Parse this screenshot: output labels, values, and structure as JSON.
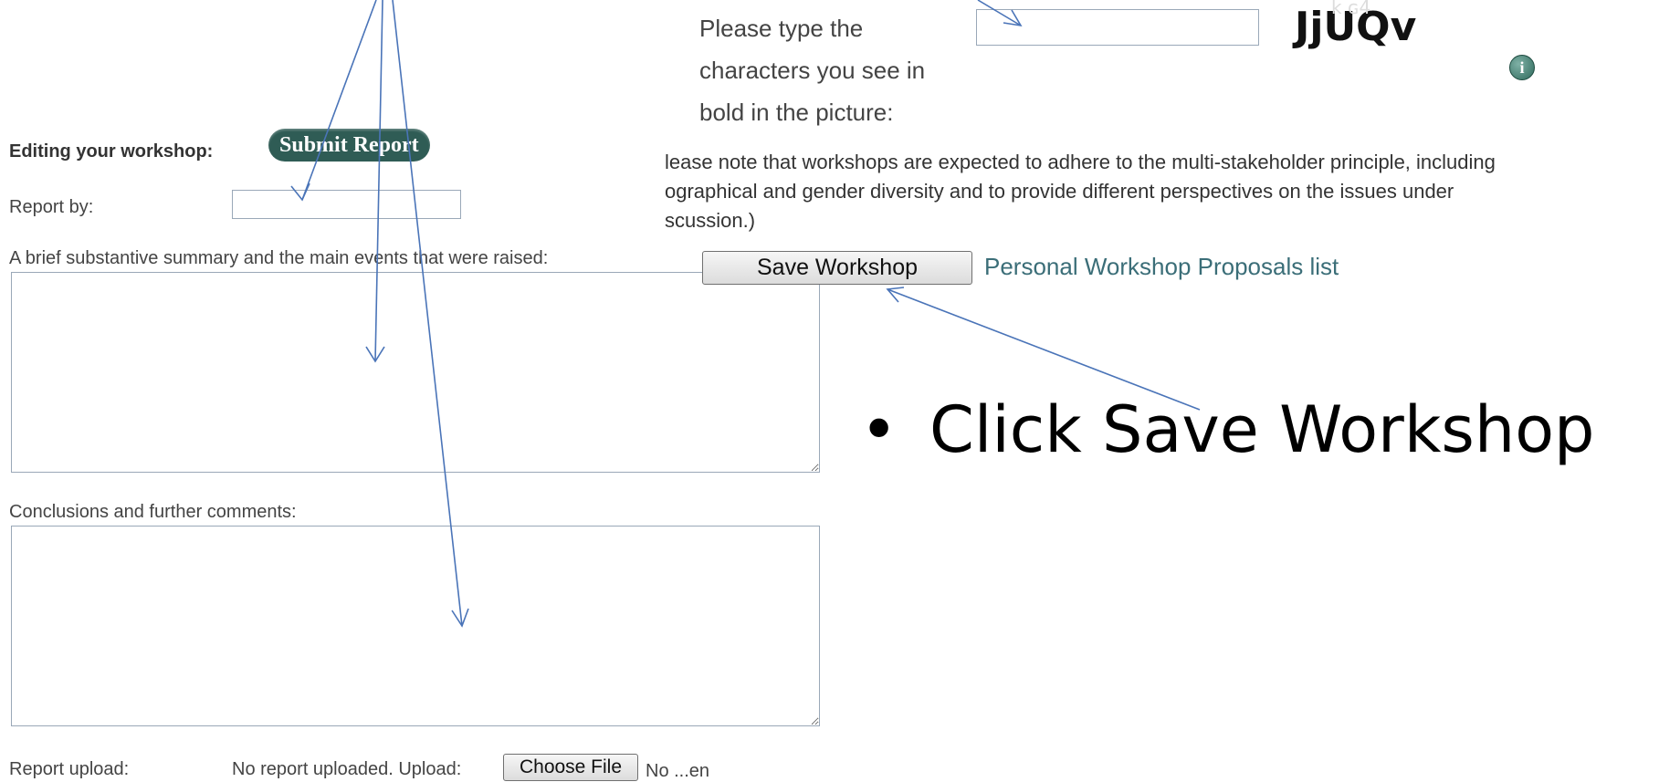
{
  "captcha": {
    "prompt_line1": "Please type the",
    "prompt_line2": "characters you see in",
    "prompt_line3": "bold in the picture:",
    "input_value": "",
    "image_text": "JjUQv",
    "info_icon": "info-icon"
  },
  "form": {
    "editing_label": "Editing your workshop:",
    "submit_report_label": "Submit Report",
    "report_by_label": "Report by:",
    "report_by_value": "",
    "summary_label": "A brief substantive summary and the main events that were raised:",
    "summary_value": "",
    "conclusions_label": "Conclusions and further comments:",
    "conclusions_value": "",
    "upload_label": "Report upload:",
    "upload_status": "No report uploaded. Upload:",
    "choose_file_label": "Choose File",
    "file_status": "No ...en"
  },
  "note": {
    "line1": "lease note that workshops are expected to adhere to the multi-stakeholder principle, including",
    "line2": "ographical and gender diversity and to provide different perspectives on the issues under",
    "line3": "scussion.)"
  },
  "actions": {
    "save_workshop_label": "Save Workshop",
    "proposals_link": "Personal Workshop Proposals list"
  },
  "annotation": {
    "bullet": "•",
    "instruction": "Click Save Workshop",
    "arrow_color": "#4a74b8"
  }
}
